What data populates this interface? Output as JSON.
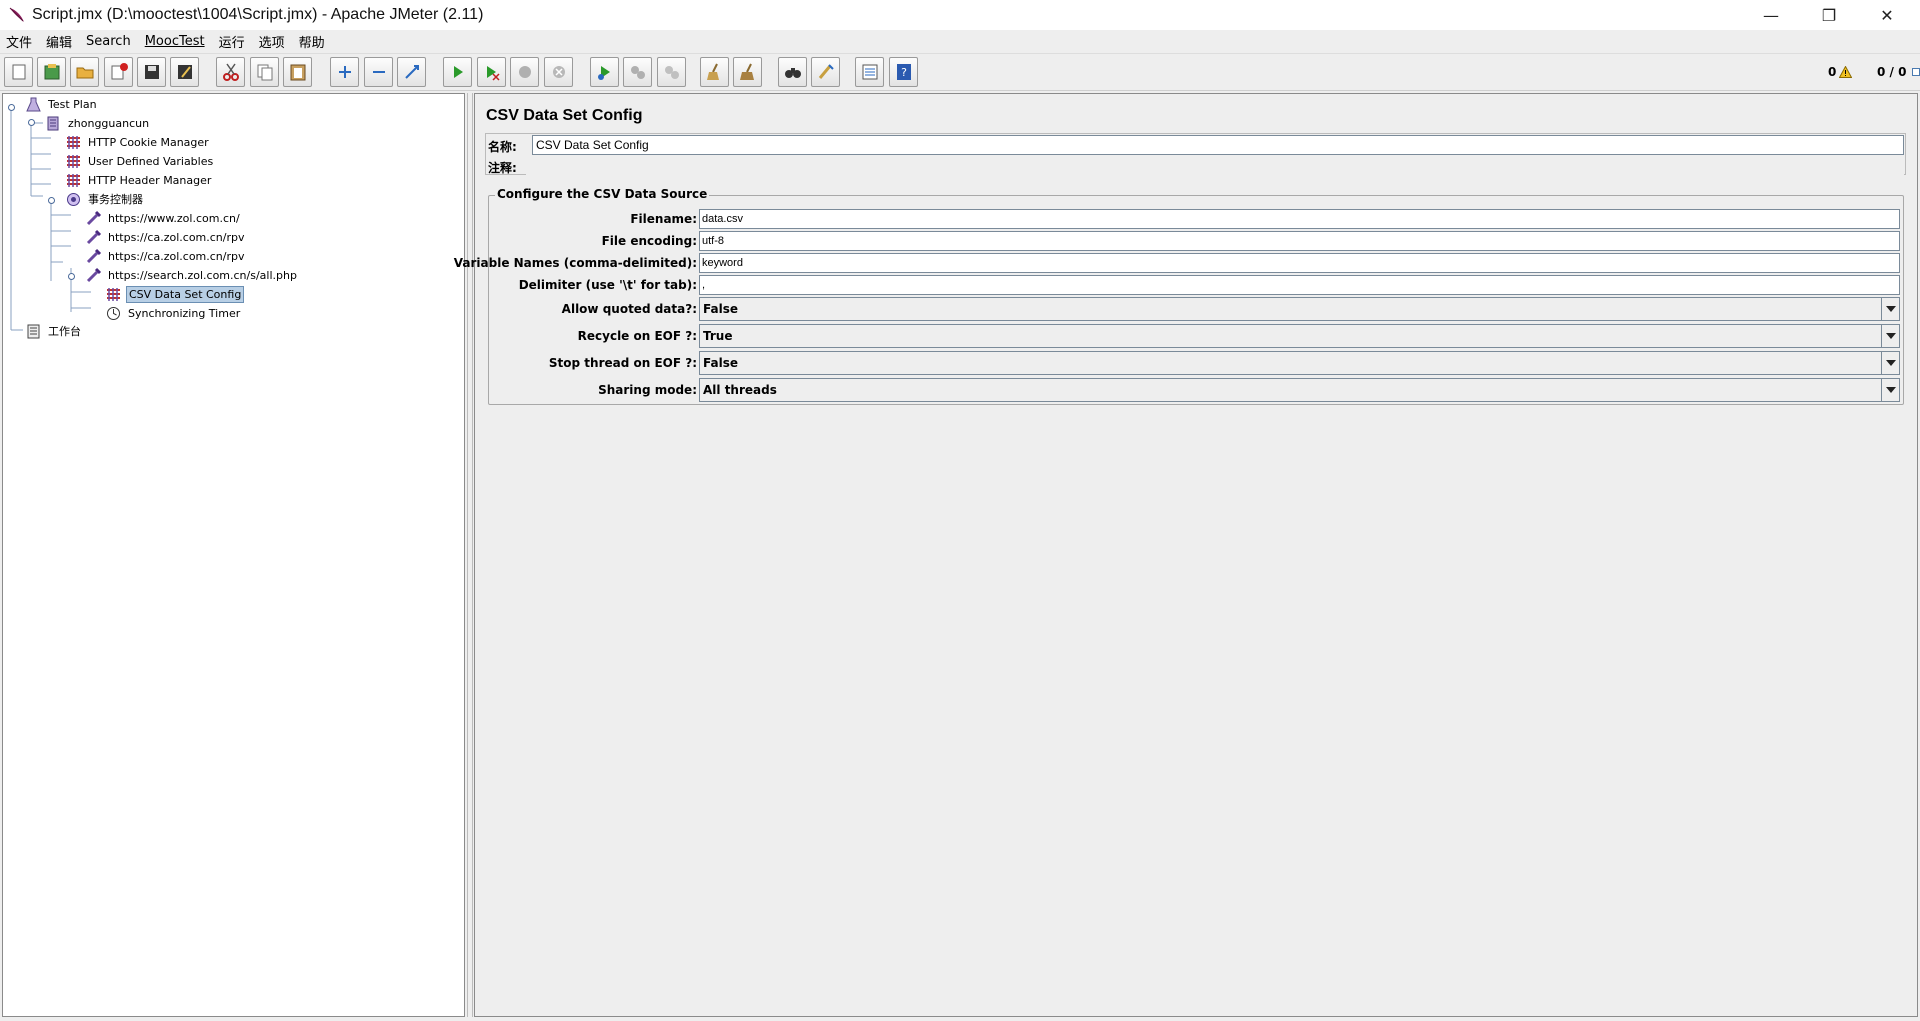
{
  "window": {
    "title": "Script.jmx (D:\\mooctest\\1004\\Script.jmx) - Apache JMeter (2.11)",
    "minimize_glyph": "—",
    "maximize_glyph": "❐",
    "close_glyph": "✕"
  },
  "menu": [
    "文件",
    "编辑",
    "Search",
    "MoocTest",
    "运行",
    "选项",
    "帮助"
  ],
  "toolbar": {
    "warning_count": "0",
    "thread_count": "0 / 0"
  },
  "tree": {
    "nodes": [
      {
        "label": "Test Plan",
        "icon": "test-plan-icon"
      },
      {
        "label": "zhongguancun",
        "icon": "thread-group-icon"
      },
      {
        "label": "HTTP Cookie Manager",
        "icon": "config-element-icon"
      },
      {
        "label": "User Defined Variables",
        "icon": "config-element-icon"
      },
      {
        "label": "HTTP Header Manager",
        "icon": "config-element-icon"
      },
      {
        "label": "事务控制器",
        "icon": "transaction-controller-icon"
      },
      {
        "label": "https://www.zol.com.cn/",
        "icon": "http-sampler-icon"
      },
      {
        "label": "https://ca.zol.com.cn/rpv",
        "icon": "http-sampler-icon"
      },
      {
        "label": "https://ca.zol.com.cn/rpv",
        "icon": "http-sampler-icon"
      },
      {
        "label": "https://search.zol.com.cn/s/all.php",
        "icon": "http-sampler-icon"
      },
      {
        "label": "CSV Data Set Config",
        "icon": "config-element-icon"
      },
      {
        "label": "Synchronizing Timer",
        "icon": "timer-icon"
      },
      {
        "label": "工作台",
        "icon": "workbench-icon"
      }
    ],
    "selected_index": 10
  },
  "config": {
    "panel_title": "CSV Data Set Config",
    "name_label": "名称:",
    "name_value": "CSV Data Set Config",
    "comment_label": "注释:",
    "comment_value": "",
    "group_title": "Configure the CSV Data Source",
    "fields": {
      "filename_label": "Filename:",
      "filename_value": "data.csv",
      "encoding_label": "File encoding:",
      "encoding_value": "utf-8",
      "varnames_label": "Variable Names (comma-delimited):",
      "varnames_value": "keyword",
      "delimiter_label": "Delimiter (use '\\t' for tab):",
      "delimiter_value": ",",
      "quoted_label": "Allow quoted data?:",
      "quoted_value": "False",
      "recycle_label": "Recycle on EOF ?:",
      "recycle_value": "True",
      "stop_label": "Stop thread on EOF ?:",
      "stop_value": "False",
      "sharing_label": "Sharing mode:",
      "sharing_value": "All threads"
    }
  }
}
